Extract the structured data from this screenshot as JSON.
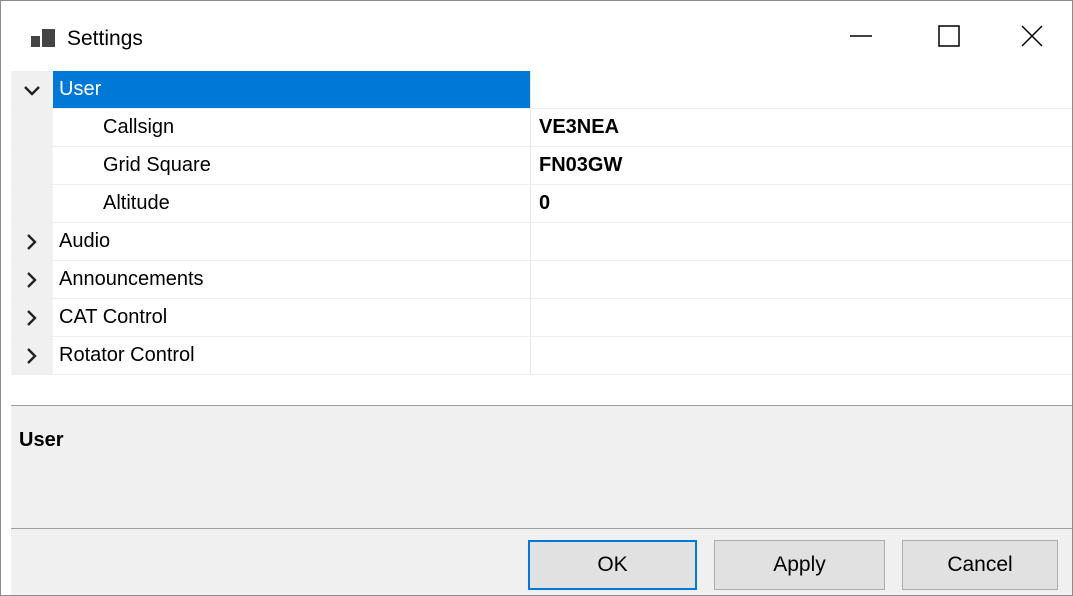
{
  "window": {
    "title": "Settings",
    "icon": "property-grid-icon"
  },
  "titlebar_buttons": {
    "minimize_icon": "minimize-icon",
    "maximize_icon": "maximize-icon",
    "close_icon": "close-icon"
  },
  "property_grid": {
    "rows": [
      {
        "type": "category",
        "name": "User",
        "expanded": true,
        "selected": true,
        "value": ""
      },
      {
        "type": "property",
        "name": "Callsign",
        "value": "VE3NEA"
      },
      {
        "type": "property",
        "name": "Grid Square",
        "value": "FN03GW"
      },
      {
        "type": "property",
        "name": "Altitude",
        "value": "0"
      },
      {
        "type": "category",
        "name": "Audio",
        "expanded": false,
        "value": ""
      },
      {
        "type": "category",
        "name": "Announcements",
        "expanded": false,
        "value": ""
      },
      {
        "type": "category",
        "name": "CAT Control",
        "expanded": false,
        "value": ""
      },
      {
        "type": "category",
        "name": "Rotator Control",
        "expanded": false,
        "value": ""
      }
    ],
    "selection_color": "#0078d7"
  },
  "help": {
    "title": "User"
  },
  "buttons": {
    "ok_label": "OK",
    "apply_label": "Apply",
    "cancel_label": "Cancel"
  }
}
